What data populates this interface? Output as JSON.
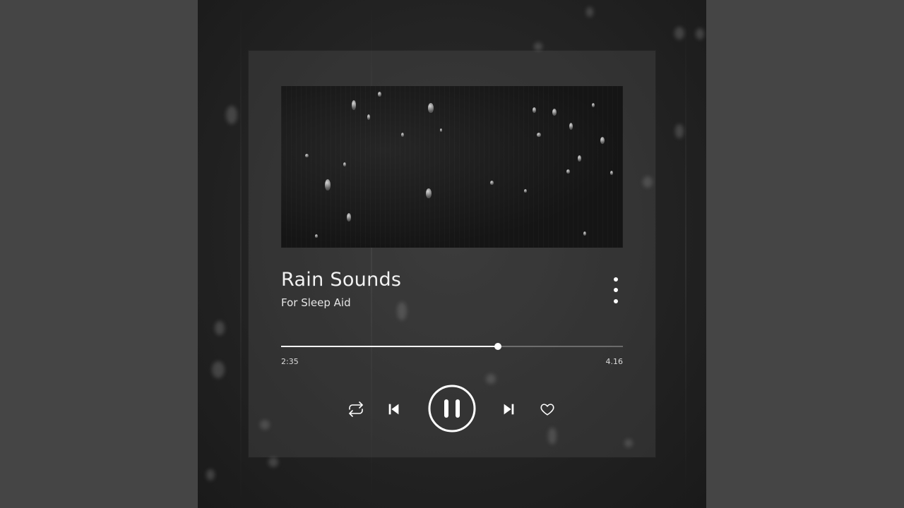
{
  "player": {
    "title": "Rain Sounds",
    "subtitle": "For Sleep Aid",
    "elapsed": "2:35",
    "total": "4.16",
    "progress_fraction": 0.634,
    "state": "playing"
  },
  "controls": {
    "repeat": "repeat-icon",
    "previous": "skip-previous-icon",
    "play_pause": "pause-icon",
    "next": "skip-next-icon",
    "like": "heart-icon",
    "more": "more-vertical-icon"
  },
  "colors": {
    "outer_background": "#454545",
    "card_overlay": "rgba(110,110,110,0.22)",
    "foreground": "#ffffff"
  }
}
